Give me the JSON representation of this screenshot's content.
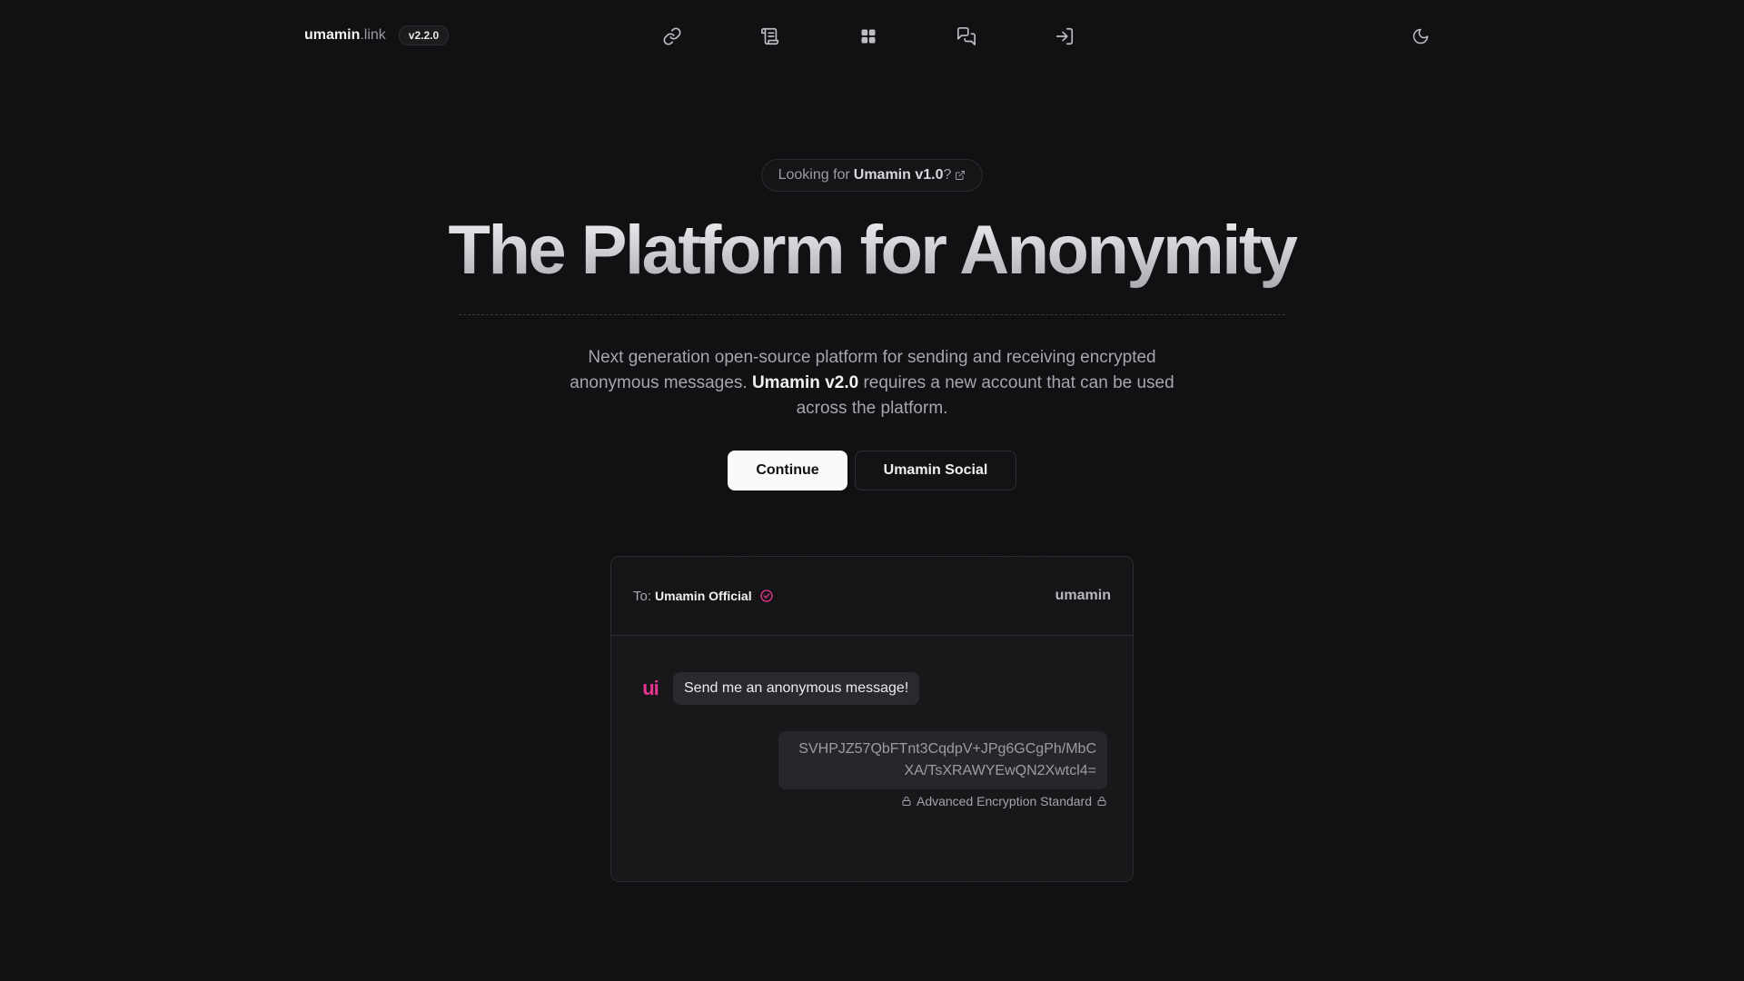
{
  "header": {
    "brand_name": "umamin",
    "brand_tld": ".link",
    "version": "v2.2.0",
    "nav_icons": [
      "link-icon",
      "scroll-icon",
      "grid-icon",
      "messages-icon",
      "login-icon"
    ],
    "theme_icon": "moon-icon"
  },
  "hero": {
    "announce_prefix": "Looking for",
    "announce_link": "Umamin v1.0",
    "announce_suffix": "?",
    "title": "The Platform for Anonymity",
    "desc_part1": "Next generation open-source platform for sending and receiving encrypted anonymous messages.",
    "desc_bold": "Umamin v2.0",
    "desc_part2": "requires a new account that can be used across the platform.",
    "primary_button": "Continue",
    "secondary_button": "Umamin Social"
  },
  "chat": {
    "to_label": "To:",
    "recipient": "Umamin Official",
    "brand": "umamin",
    "avatar_text": "ui",
    "incoming_message": "Send me an anonymous message!",
    "encrypted_message": "SVHPJZ57QbFTnt3CqdpV+JPg6GCgPh/MbCXA/TsXRAWYEwQN2Xwtcl4=",
    "encryption_label": "Advanced Encryption Standard"
  },
  "colors": {
    "background": "#111113",
    "accent_pink": "#e6358f",
    "primary_button_bg": "#fafafa"
  }
}
